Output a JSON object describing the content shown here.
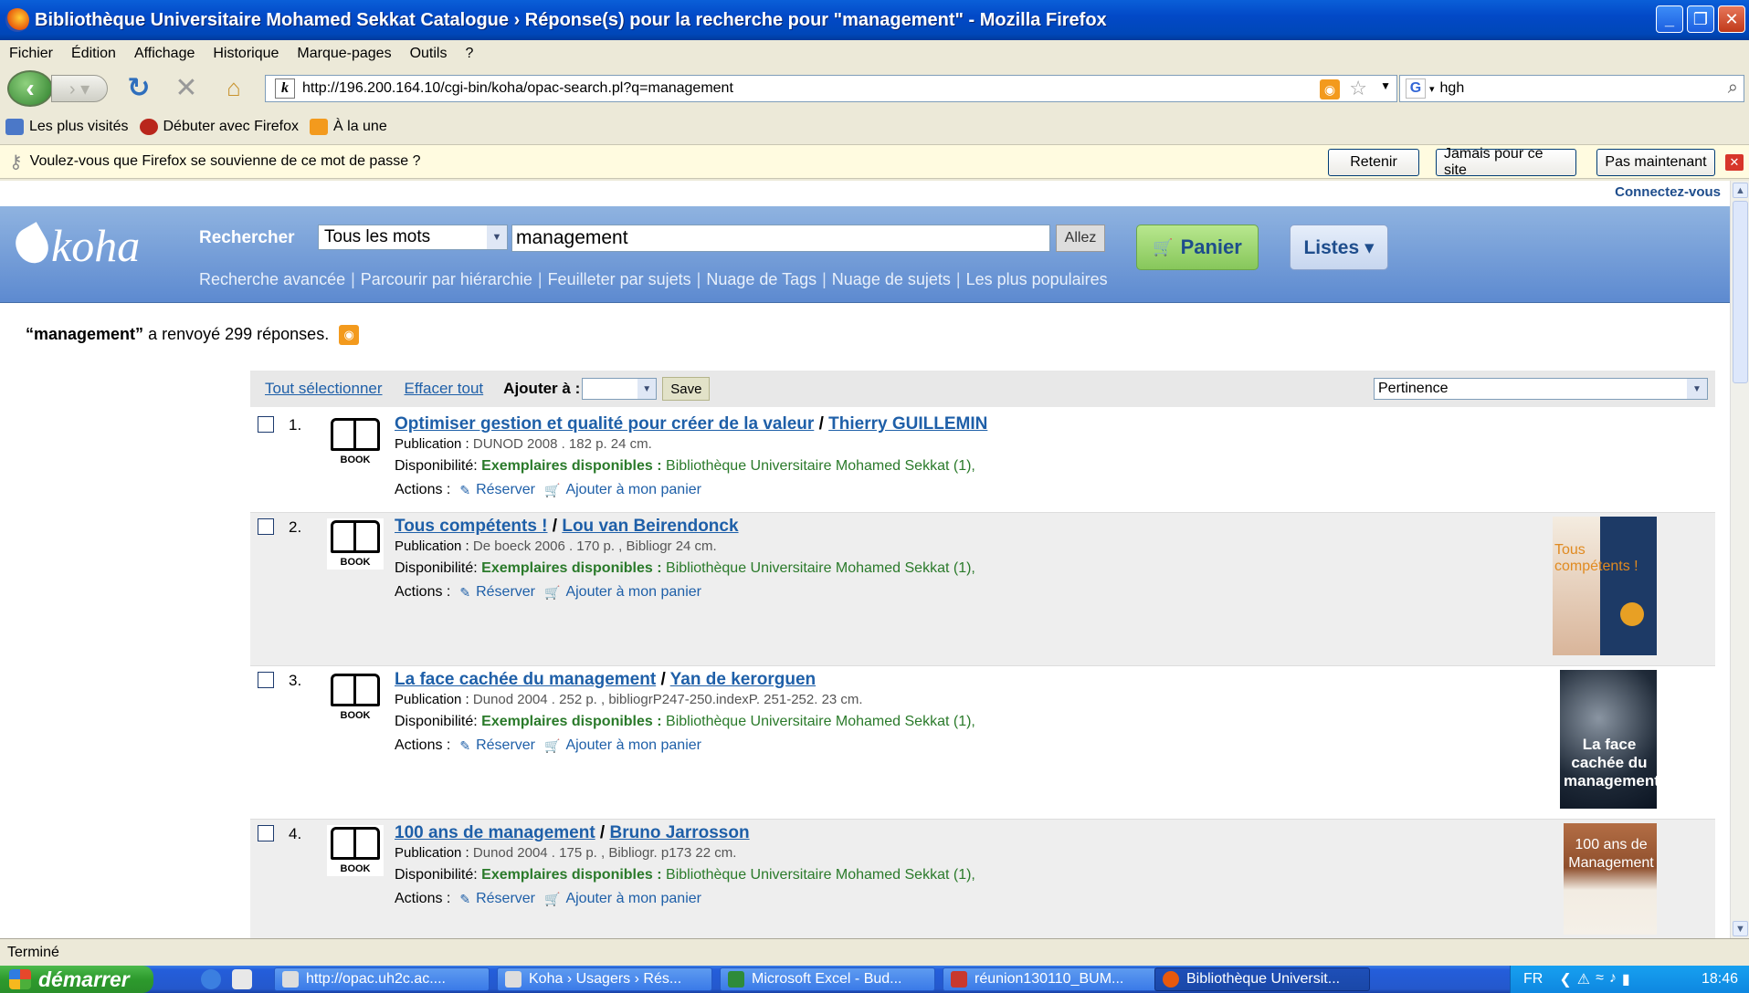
{
  "window": {
    "title": "Bibliothèque Universitaire Mohamed Sekkat Catalogue › Réponse(s) pour la recherche pour \"management\" - Mozilla Firefox"
  },
  "menu": [
    "Fichier",
    "Édition",
    "Affichage",
    "Historique",
    "Marque-pages",
    "Outils",
    "?"
  ],
  "nav": {
    "url": "http://196.200.164.10/cgi-bin/koha/opac-search.pl?q=management",
    "search_value": "hgh"
  },
  "bookmarks": [
    "Les plus visités",
    "Débuter avec Firefox",
    "À la une"
  ],
  "password_bar": {
    "message": "Voulez-vous que Firefox se souvienne de ce mot de passe ?",
    "remember": "Retenir",
    "never": "Jamais pour ce site",
    "not_now": "Pas maintenant"
  },
  "koha": {
    "connect": "Connectez-vous",
    "logo": "koha",
    "search_label": "Rechercher",
    "index": "Tous les mots",
    "query": "management",
    "go": "Allez",
    "cart": "Panier",
    "lists": "Listes ▾",
    "sublinks": [
      "Recherche avancée",
      "Parcourir par hiérarchie",
      "Feuilleter par sujets",
      "Nuage de Tags",
      "Nuage de sujets",
      "Les plus populaires"
    ]
  },
  "results": {
    "query_quoted": "“management”",
    "count_text": "a renvoyé 299 réponses.",
    "select_all": "Tout sélectionner",
    "clear_all": "Effacer tout",
    "add_to": "Ajouter à :",
    "save": "Save",
    "sort": "Pertinence",
    "pub_label": "Publication :",
    "dispo_label": "Disponibilité:",
    "dispo_status": "Exemplaires disponibles :",
    "actions_label": "Actions :",
    "reserve": "Réserver",
    "add_cart": "Ajouter à mon panier",
    "book_label": "BOOK",
    "items": [
      {
        "num": "1.",
        "title": "Optimiser gestion et qualité pour créer de la valeur",
        "author": "Thierry GUILLEMIN",
        "pub": "DUNOD 2008 . 182 p. 24 cm.",
        "branch": "Bibliothèque Universitaire Mohamed Sekkat (1),",
        "cover_text": ""
      },
      {
        "num": "2.",
        "title": "Tous compétents !",
        "author": "Lou van Beirendonck",
        "pub": "De boeck 2006 . 170 p. , Bibliogr 24 cm.",
        "branch": "Bibliothèque Universitaire Mohamed Sekkat (1),",
        "cover_text": "Tous compétents !"
      },
      {
        "num": "3.",
        "title": "La face cachée du management",
        "author": "Yan de kerorguen",
        "pub": "Dunod 2004 . 252 p. , bibliogrP247-250.indexP. 251-252. 23 cm.",
        "branch": "Bibliothèque Universitaire Mohamed Sekkat (1),",
        "cover_text": "La face cachée du management"
      },
      {
        "num": "4.",
        "title": "100 ans de management",
        "author": "Bruno Jarrosson",
        "pub": "Dunod 2004 . 175 p. , Bibliogr. p173 22 cm.",
        "branch": "Bibliothèque Universitaire Mohamed Sekkat (1),",
        "cover_text": "100 ans de Management"
      }
    ]
  },
  "status": "Terminé",
  "taskbar": {
    "start": "démarrer",
    "tasks": [
      "http://opac.uh2c.ac....",
      "Koha › Usagers › Rés...",
      "Microsoft Excel - Bud...",
      "réunion130110_BUM...",
      "Bibliothèque Universit..."
    ],
    "lang": "FR",
    "clock": "18:46"
  }
}
